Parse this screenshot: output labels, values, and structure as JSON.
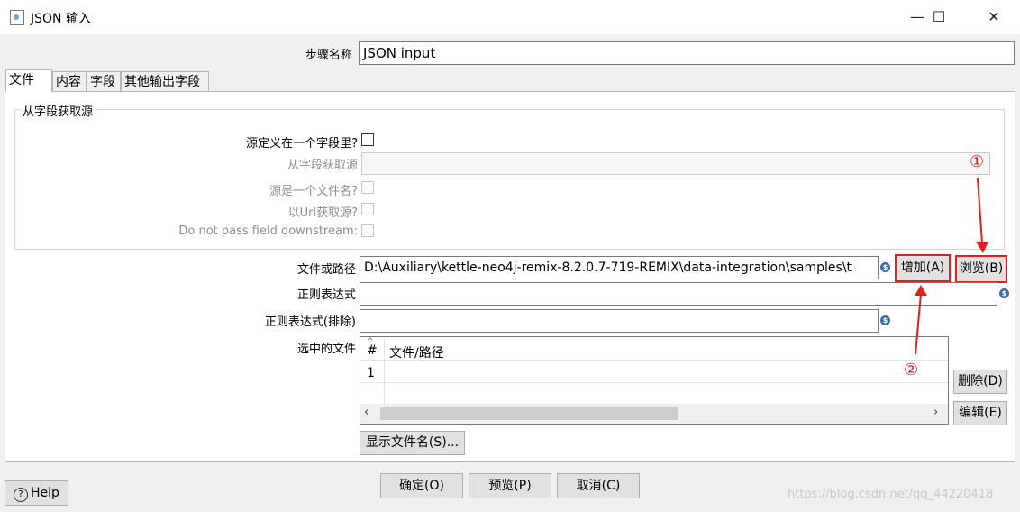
{
  "window": {
    "title": "JSON 输入",
    "minimize_icon": "minimize-icon",
    "maximize_icon": "maximize-icon",
    "close_icon": "close-icon"
  },
  "step_name": {
    "label": "步骤名称",
    "value": "JSON input"
  },
  "tabs": [
    {
      "label": "文件"
    },
    {
      "label": "内容"
    },
    {
      "label": "字段"
    },
    {
      "label": "其他输出字段"
    }
  ],
  "group": {
    "title": "从字段获取源",
    "source_in_field": {
      "label": "源定义在一个字段里?"
    },
    "source_field": {
      "label": "从字段获取源",
      "value": ""
    },
    "source_is_filename": {
      "label": "源是一个文件名?"
    },
    "read_url": {
      "label": "以Url获取源?"
    },
    "do_not_pass": {
      "label": "Do not pass field downstream:"
    }
  },
  "file_path": {
    "label": "文件或路径",
    "value": "D:\\Auxiliary\\kettle-neo4j-remix-8.2.0.7-719-REMIX\\data-integration\\samples\\t"
  },
  "regex": {
    "label": "正则表达式",
    "value": ""
  },
  "regex_exclude": {
    "label": "正则表达式(排除)",
    "value": ""
  },
  "selected_files": {
    "label": "选中的文件",
    "columns": [
      "#",
      "文件/路径"
    ],
    "rows": [
      {
        "num": "1",
        "path": ""
      }
    ]
  },
  "buttons": {
    "add": "增加(A)",
    "browse": "浏览(B)",
    "delete": "删除(D)",
    "edit": "编辑(E)",
    "show_filenames": "显示文件名(S)...",
    "ok": "确定(O)",
    "preview": "预览(P)",
    "cancel": "取消(C)",
    "help": "Help"
  },
  "annotations": {
    "one": "①",
    "two": "②"
  },
  "watermark": "https://blog.csdn.net/qq_44220418",
  "colors": {
    "annotation_red": "#e02020",
    "variable_icon": "#3b6fa5"
  }
}
